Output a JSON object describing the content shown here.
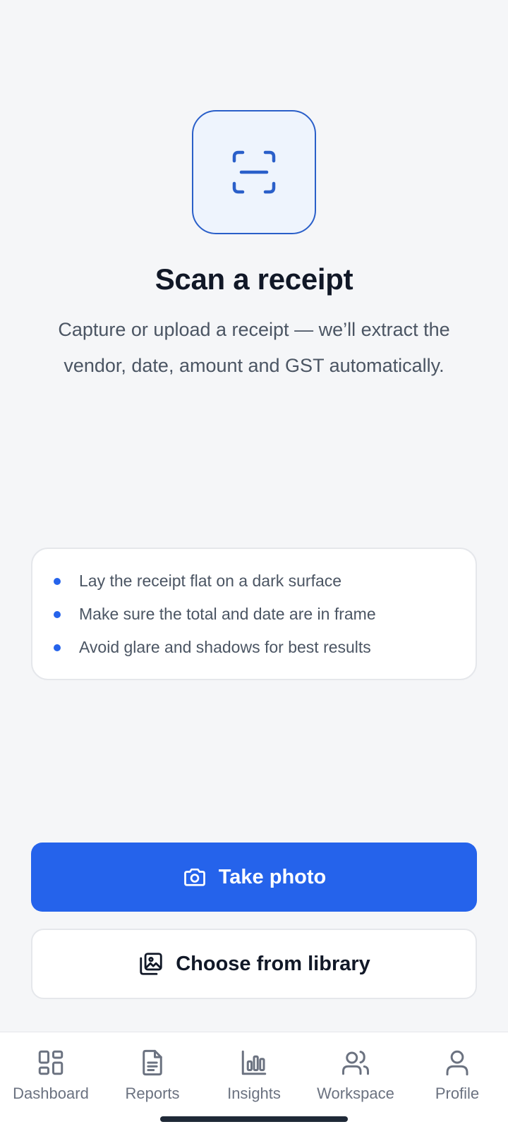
{
  "hero": {
    "icon": "scan-icon",
    "title": "Scan a receipt",
    "subtitle": "Capture or upload a receipt — we’ll extract the vendor, date, amount and GST automatically."
  },
  "tips": [
    {
      "text": "Lay the receipt flat on a dark surface"
    },
    {
      "text": "Make sure the total and date are in frame"
    },
    {
      "text": "Avoid glare and shadows for best results"
    }
  ],
  "actions": {
    "take_photo": {
      "label": "Take photo",
      "icon": "camera-icon"
    },
    "choose_library": {
      "label": "Choose from library",
      "icon": "gallery-icon"
    }
  },
  "nav": {
    "items": [
      {
        "label": "Dashboard",
        "icon": "dashboard-icon"
      },
      {
        "label": "Reports",
        "icon": "reports-icon"
      },
      {
        "label": "Insights",
        "icon": "insights-icon"
      },
      {
        "label": "Workspace",
        "icon": "workspace-icon"
      },
      {
        "label": "Profile",
        "icon": "profile-icon"
      }
    ]
  },
  "colors": {
    "accent": "#2563eb",
    "tile_border": "#2a5fc9",
    "tile_bg": "#eef4fd",
    "background": "#f5f6f8",
    "text_muted": "#4b5563"
  }
}
